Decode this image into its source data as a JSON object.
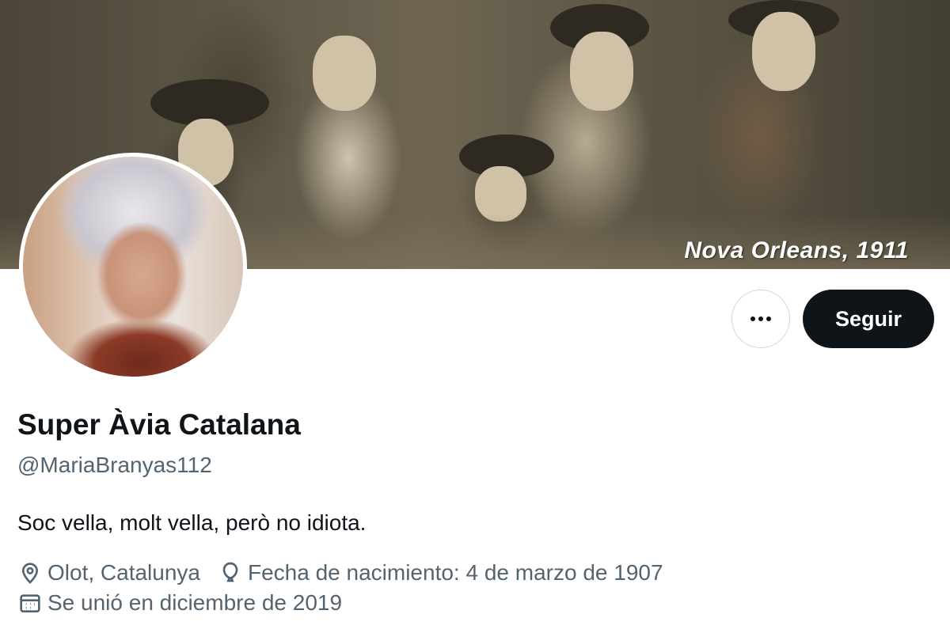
{
  "banner": {
    "caption": "Nova Orleans, 1911"
  },
  "actions": {
    "more_icon": "more-horizontal-icon",
    "follow_label": "Seguir"
  },
  "profile": {
    "display_name": "Super Àvia Catalana",
    "handle": "@MariaBranyas112",
    "bio": "Soc vella, molt vella, però no idiota.",
    "location": "Olot, Catalunya",
    "birthday": "Fecha de nacimiento: 4 de marzo de 1907",
    "joined": "Se unió en diciembre de 2019"
  },
  "colors": {
    "text_primary": "#0f1419",
    "text_secondary": "#536471",
    "follow_button_bg": "#0f1419",
    "border": "#cfd9de"
  }
}
